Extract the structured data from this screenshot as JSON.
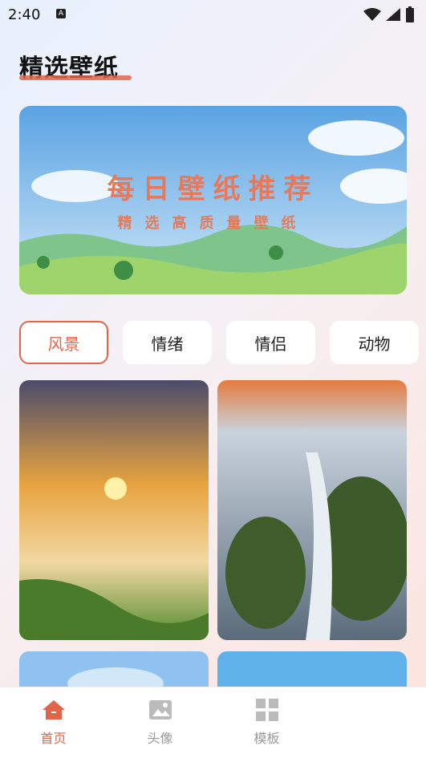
{
  "status": {
    "time": "2:40"
  },
  "header": {
    "title": "精选壁纸"
  },
  "banner": {
    "title": "每日壁纸推荐",
    "subtitle": "精选高质量壁纸"
  },
  "categories": [
    "风景",
    "情绪",
    "情侣",
    "动物"
  ],
  "nav": {
    "home": "首页",
    "avatar": "头像",
    "template": "模板"
  },
  "colors": {
    "accent": "#e0664b"
  }
}
